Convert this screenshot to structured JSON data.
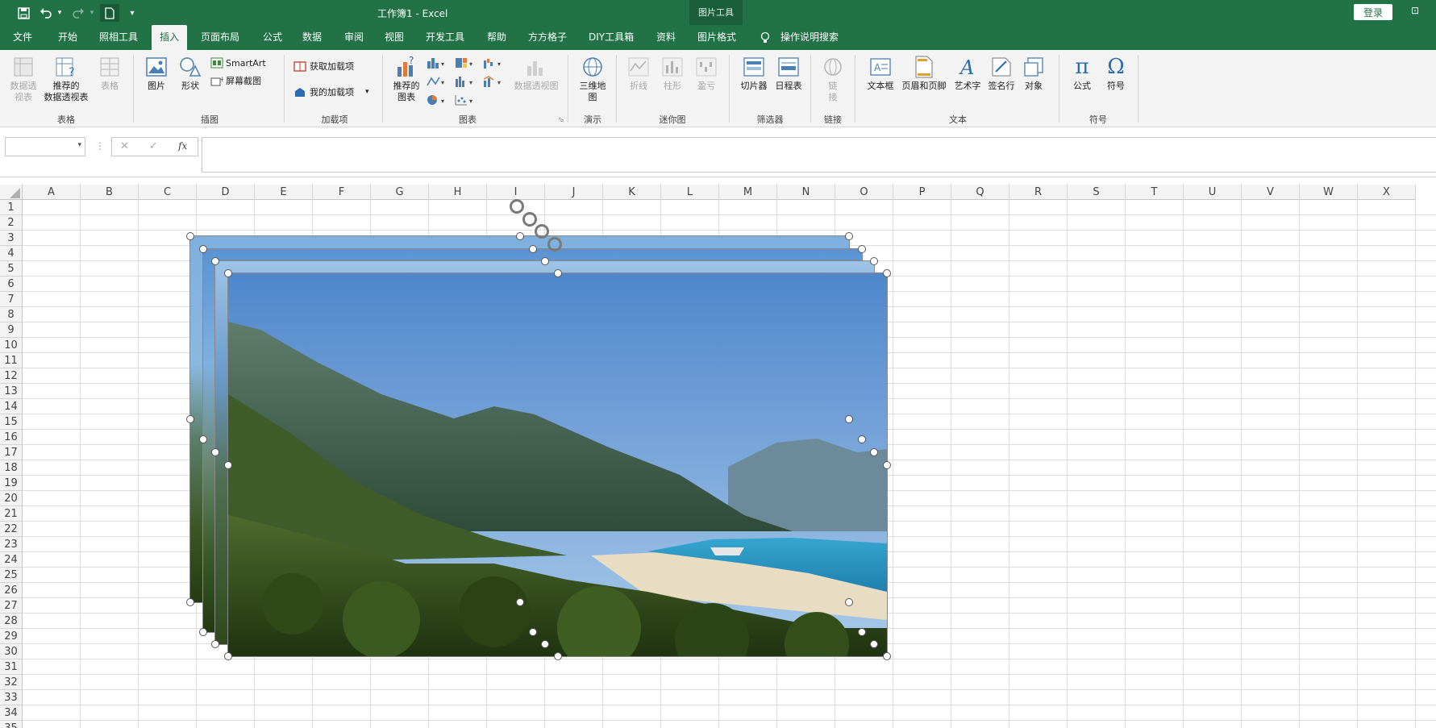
{
  "titlebar": {
    "doc_title": "工作簿1  -  Excel",
    "context_label": "图片工具",
    "login_label": "登录",
    "window_control": "⊡",
    "quick_access": [
      {
        "name": "save-icon",
        "glyph": "🖫"
      },
      {
        "name": "undo-icon",
        "glyph": "↶"
      },
      {
        "name": "undo-dropdown-icon",
        "glyph": "⌄"
      },
      {
        "name": "redo-icon",
        "glyph": "↷"
      },
      {
        "name": "redo-dropdown-icon",
        "glyph": "⌄"
      },
      {
        "name": "new-document-icon",
        "glyph": "🗋"
      },
      {
        "name": "customize-qat-icon",
        "glyph": "⩡"
      }
    ]
  },
  "tabs": [
    "文件",
    "开始",
    "照相工具",
    "插入",
    "页面布局",
    "公式",
    "数据",
    "审阅",
    "视图",
    "开发工具",
    "帮助",
    "方方格子",
    "DIY工具箱",
    "资料",
    "图片格式",
    "操作说明搜索"
  ],
  "active_tab": "插入",
  "ribbon": {
    "table_group": {
      "label": "表格",
      "pivot": "数据透\n视表",
      "rec_pivot": "推荐的\n数据透视表",
      "table": "表格"
    },
    "illus_group": {
      "label": "插图",
      "picture": "图片",
      "shapes": "形状",
      "smartart": "SmartArt",
      "screenshot": "屏幕截图"
    },
    "addin_group": {
      "label": "加载项",
      "get": "获取加载项",
      "mine": "我的加载项"
    },
    "chart_group": {
      "label": "图表",
      "rec_chart": "推荐的\n图表",
      "pivot_chart": "数据透视图"
    },
    "tour_group": {
      "label": "演示",
      "map3d": "三维地\n图"
    },
    "spark_group": {
      "label": "迷你图",
      "line": "折线",
      "column": "柱形",
      "winloss": "盈亏"
    },
    "filter_group": {
      "label": "筛选器",
      "slicer": "切片器",
      "timeline": "日程表"
    },
    "link_group": {
      "label": "链接",
      "link": "链\n接"
    },
    "text_group": {
      "label": "文本",
      "textbox": "文本框",
      "headerfooter": "页眉和页脚",
      "wordart": "艺术字",
      "signature": "签名行",
      "object": "对象"
    },
    "symbol_group": {
      "label": "符号",
      "equation": "公式",
      "symbol": "符号"
    }
  },
  "formula_bar": {
    "name_box": "",
    "cancel": "✕",
    "enter": "✓",
    "fx": "fx",
    "formula": ""
  },
  "sheet": {
    "columns": [
      "A",
      "B",
      "C",
      "D",
      "E",
      "F",
      "G",
      "H",
      "I",
      "J",
      "K",
      "L",
      "M",
      "N",
      "O",
      "P",
      "Q",
      "R",
      "S",
      "T",
      "U",
      "V",
      "W",
      "X"
    ],
    "rows": [
      "1",
      "2",
      "3",
      "4",
      "5",
      "6",
      "7",
      "8",
      "9",
      "10",
      "11",
      "12",
      "13",
      "14",
      "15",
      "16",
      "17",
      "18",
      "19",
      "20",
      "21",
      "22",
      "23",
      "24",
      "25",
      "26",
      "27",
      "28",
      "29",
      "30",
      "31",
      "32",
      "33",
      "34",
      "35"
    ]
  },
  "colors": {
    "brand": "#217346",
    "ribbon": "#f3f3f3",
    "sky": "#5b93d3",
    "sea": "#2a9dc6",
    "forest": "#3c5b24"
  }
}
